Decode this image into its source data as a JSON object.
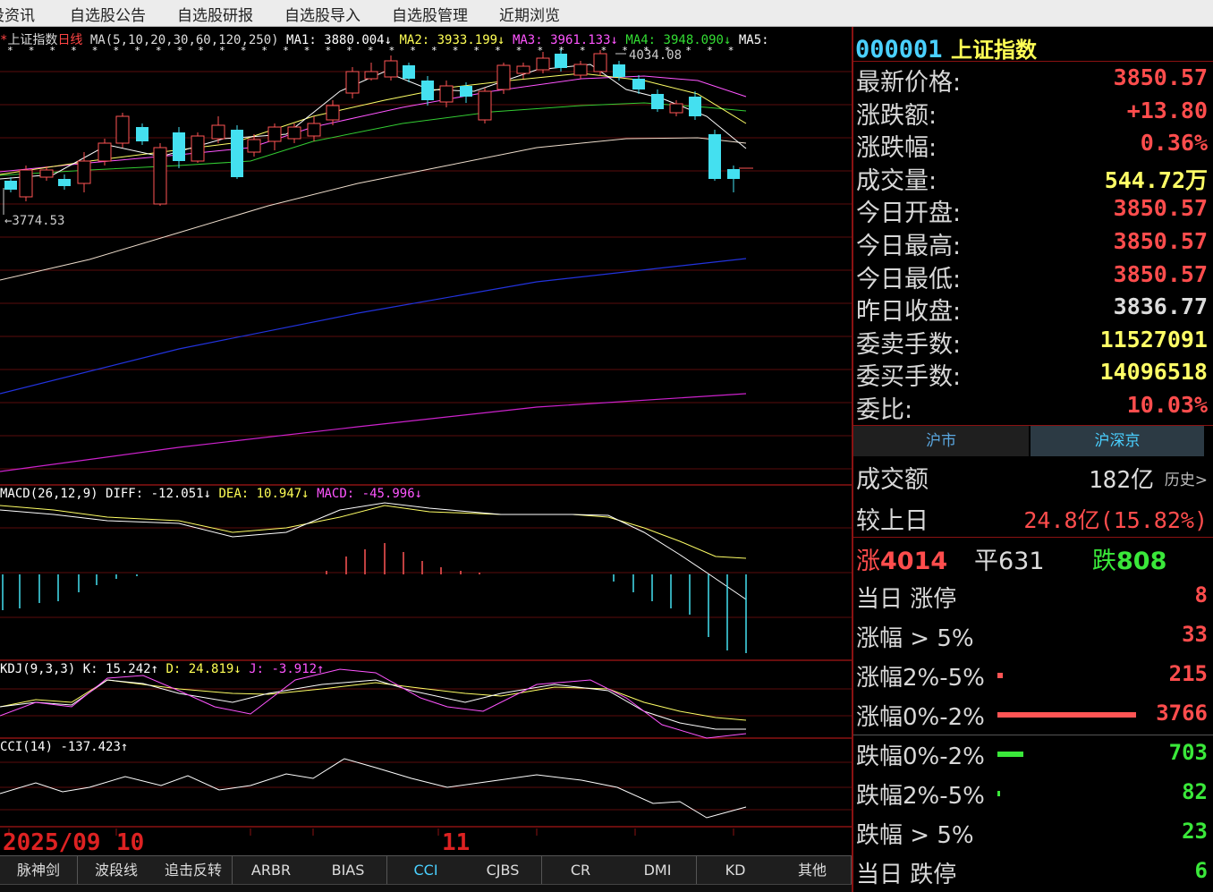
{
  "menu": [
    "投资讯",
    "自选股公告",
    "自选股研报",
    "自选股导入",
    "自选股管理",
    "近期浏览"
  ],
  "chart": {
    "title_name": "上证指数",
    "title_period": "日线",
    "ma_params": "MA(5,10,20,30,60,120,250)",
    "ma_values": [
      {
        "text": "MA1: 3880.004↓",
        "color": "#ffffff"
      },
      {
        "text": "MA2: 3933.199↓",
        "color": "#ffff55"
      },
      {
        "text": "MA3: 3961.133↓",
        "color": "#ff55ff"
      },
      {
        "text": "MA4: 3948.090↓",
        "color": "#33dd33"
      },
      {
        "text": "MA5:",
        "color": "#ffffff"
      }
    ],
    "high_label": "4034.08",
    "low_label": "3774.53",
    "macd_line": [
      {
        "text": "MACD(26,12,9)",
        "color": "#ffffff"
      },
      {
        "text": "DIFF: -12.051↓",
        "color": "#ffffff"
      },
      {
        "text": "DEA: 10.947↓",
        "color": "#ffff55"
      },
      {
        "text": "MACD: -45.996↓",
        "color": "#ff55ff"
      }
    ],
    "kdj_line": [
      {
        "text": "KDJ(9,3,3)",
        "color": "#ffffff"
      },
      {
        "text": "K: 15.242↑",
        "color": "#ffffff"
      },
      {
        "text": "D: 24.819↓",
        "color": "#ffff55"
      },
      {
        "text": "J: -3.912↑",
        "color": "#ff55ff"
      }
    ],
    "cci_line": [
      {
        "text": "CCI(14)",
        "color": "#ffffff"
      },
      {
        "text": "-137.423↑",
        "color": "#ffffff"
      }
    ],
    "x_labels": [
      {
        "text": "2025/09"
      },
      {
        "text": "10"
      },
      {
        "text": "11"
      }
    ]
  },
  "tabs": [
    "脉神剑",
    "波段线",
    "追击反转",
    "ARBR",
    "BIAS",
    "CCI",
    "CJBS",
    "CR",
    "DMI",
    "KD",
    "其他"
  ],
  "active_tab": "CCI",
  "quote": {
    "code": "000001",
    "name": "上证指数",
    "rows": [
      {
        "label": "最新价格:",
        "value": "3850.57",
        "cls": "red"
      },
      {
        "label": "涨跌额:",
        "value": "+13.80",
        "cls": "red"
      },
      {
        "label": "涨跌幅:",
        "value": "0.36%",
        "cls": "red"
      },
      {
        "label": "成交量:",
        "value": "544.72万",
        "cls": "yellow"
      },
      {
        "label": "今日开盘:",
        "value": "3850.57",
        "cls": "red"
      },
      {
        "label": "今日最高:",
        "value": "3850.57",
        "cls": "red"
      },
      {
        "label": "今日最低:",
        "value": "3850.57",
        "cls": "red"
      },
      {
        "label": "昨日收盘:",
        "value": "3836.77",
        "cls": "white"
      },
      {
        "label": "委卖手数:",
        "value": "11527091",
        "cls": "yellow"
      },
      {
        "label": "委买手数:",
        "value": "14096518",
        "cls": "yellow"
      },
      {
        "label": "委比:",
        "value": "10.03%",
        "cls": "red"
      }
    ]
  },
  "market": {
    "seg_sh": "沪市",
    "seg_all": "沪深京",
    "turnover_label": "成交额",
    "turnover_value": "182亿",
    "history_link": "历史>",
    "compare_label": "较上日",
    "compare_value": "24.8亿(15.82%)",
    "up_label": "涨",
    "up_count": "4014",
    "flat_label": "平",
    "flat_count": "631",
    "down_label": "跌",
    "down_count": "808",
    "stats": [
      {
        "label": "当日 涨停",
        "value": "8",
        "cls": "red",
        "fill": 0
      },
      {
        "label": "涨幅 > 5%",
        "value": "33",
        "cls": "red",
        "fill": 0
      },
      {
        "label": "涨幅2%-5%",
        "value": "215",
        "cls": "red",
        "fill": 0.04
      },
      {
        "label": "涨幅0%-2%",
        "value": "3766",
        "cls": "red",
        "fill": 1.0
      },
      {
        "label": "跌幅0%-2%",
        "value": "703",
        "cls": "green",
        "fill": 0.19
      },
      {
        "label": "跌幅2%-5%",
        "value": "82",
        "cls": "green",
        "fill": 0.01
      },
      {
        "label": "跌幅 > 5%",
        "value": "23",
        "cls": "green",
        "fill": 0
      },
      {
        "label": "当日 跌停",
        "value": "6",
        "cls": "green",
        "fill": 0
      }
    ]
  }
}
